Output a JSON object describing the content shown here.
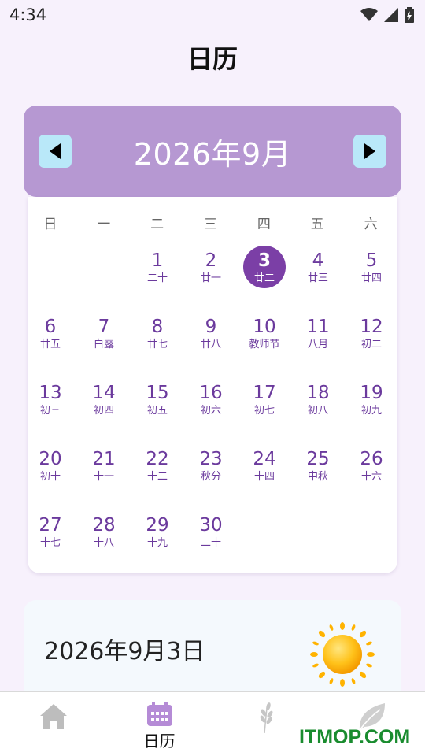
{
  "status": {
    "time": "4:34"
  },
  "title": "日历",
  "month": {
    "label": "2026年9月"
  },
  "weekdays": [
    "日",
    "一",
    "二",
    "三",
    "四",
    "五",
    "六"
  ],
  "days": [
    {
      "n": "",
      "l": ""
    },
    {
      "n": "",
      "l": ""
    },
    {
      "n": "1",
      "l": "二十"
    },
    {
      "n": "2",
      "l": "廿一"
    },
    {
      "n": "3",
      "l": "廿二",
      "selected": true
    },
    {
      "n": "4",
      "l": "廿三"
    },
    {
      "n": "5",
      "l": "廿四"
    },
    {
      "n": "6",
      "l": "廿五"
    },
    {
      "n": "7",
      "l": "白露"
    },
    {
      "n": "8",
      "l": "廿七"
    },
    {
      "n": "9",
      "l": "廿八"
    },
    {
      "n": "10",
      "l": "教师节"
    },
    {
      "n": "11",
      "l": "八月"
    },
    {
      "n": "12",
      "l": "初二"
    },
    {
      "n": "13",
      "l": "初三"
    },
    {
      "n": "14",
      "l": "初四"
    },
    {
      "n": "15",
      "l": "初五"
    },
    {
      "n": "16",
      "l": "初六"
    },
    {
      "n": "17",
      "l": "初七"
    },
    {
      "n": "18",
      "l": "初八"
    },
    {
      "n": "19",
      "l": "初九"
    },
    {
      "n": "20",
      "l": "初十"
    },
    {
      "n": "21",
      "l": "十一"
    },
    {
      "n": "22",
      "l": "十二"
    },
    {
      "n": "23",
      "l": "秋分"
    },
    {
      "n": "24",
      "l": "十四"
    },
    {
      "n": "25",
      "l": "中秋"
    },
    {
      "n": "26",
      "l": "十六"
    },
    {
      "n": "27",
      "l": "十七"
    },
    {
      "n": "28",
      "l": "十八"
    },
    {
      "n": "29",
      "l": "十九"
    },
    {
      "n": "30",
      "l": "二十"
    }
  ],
  "selected_date": "2026年9月3日",
  "weather_icon": "sun-icon",
  "nav": [
    {
      "icon": "home-icon",
      "label": ""
    },
    {
      "icon": "calendar-icon",
      "label": "日历"
    },
    {
      "icon": "wheat-icon",
      "label": ""
    },
    {
      "icon": "leaf-icon",
      "label": ""
    }
  ],
  "watermark": "ITMOP.COM",
  "colors": {
    "accent": "#7b3fa6",
    "header": "#b698d2",
    "nav_button": "#b9e8f9",
    "day_text": "#6b3a9d"
  }
}
